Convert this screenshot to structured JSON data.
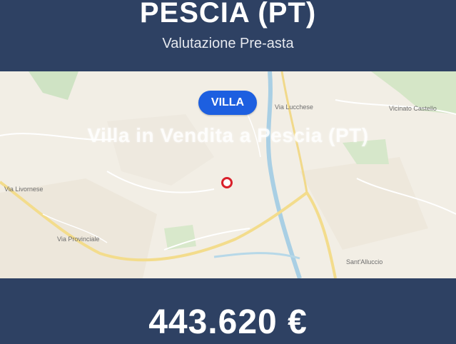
{
  "header": {
    "title": "PESCIA (PT)",
    "subtitle": "Valutazione Pre-asta"
  },
  "map": {
    "badge_label": "VILLA",
    "watermark": "Villa in Vendita a Pescia (PT)",
    "place_labels": [
      "Via Livornese",
      "Via Provinciale",
      "Via Lucchese",
      "Vicinato Castello",
      "Sant'Alluccio"
    ],
    "pin_icon": "location-marker-icon"
  },
  "footer": {
    "price": "443.620 €"
  },
  "colors": {
    "banner": "#2e4163",
    "badge": "#1d5fe0",
    "pin": "#d9202a"
  }
}
